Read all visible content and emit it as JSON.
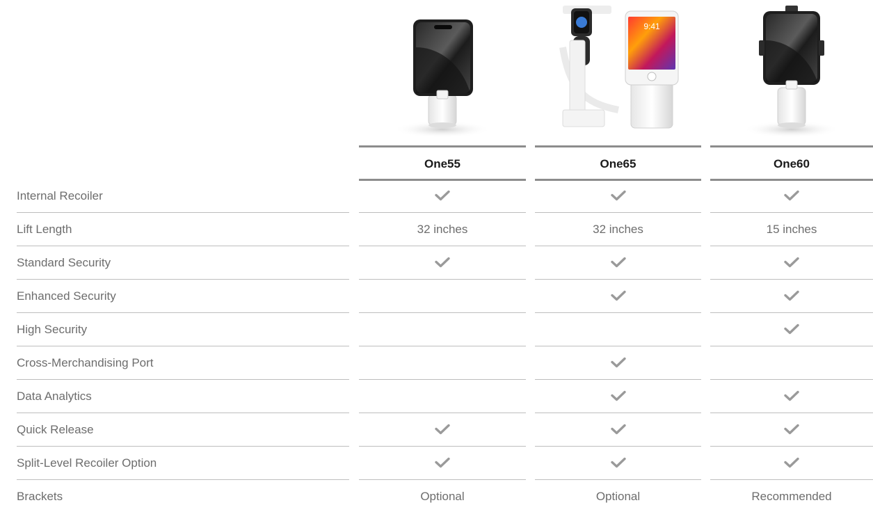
{
  "products": [
    {
      "name": "One55",
      "image_icon": "phone-stand-one55-icon"
    },
    {
      "name": "One65",
      "image_icon": "phone-watch-stand-one65-icon"
    },
    {
      "name": "One60",
      "image_icon": "phone-stand-one60-icon"
    }
  ],
  "product_image_text": {
    "phone_clock": "9:41"
  },
  "rows": [
    {
      "label": "Internal Recoiler",
      "values": [
        "check",
        "check",
        "check"
      ]
    },
    {
      "label": "Lift Length",
      "values": [
        "32 inches",
        "32 inches",
        "15 inches"
      ]
    },
    {
      "label": "Standard Security",
      "values": [
        "check",
        "check",
        "check"
      ]
    },
    {
      "label": "Enhanced Security",
      "values": [
        "",
        "check",
        "check"
      ]
    },
    {
      "label": "High Security",
      "values": [
        "",
        "",
        "check"
      ]
    },
    {
      "label": "Cross-Merchandising Port",
      "values": [
        "",
        "check",
        ""
      ]
    },
    {
      "label": "Data Analytics",
      "values": [
        "",
        "check",
        "check"
      ]
    },
    {
      "label": "Quick Release",
      "values": [
        "check",
        "check",
        "check"
      ]
    },
    {
      "label": "Split-Level Recoiler Option",
      "values": [
        "check",
        "check",
        "check"
      ]
    },
    {
      "label": "Brackets",
      "values": [
        "Optional",
        "Optional",
        "Recommended"
      ]
    }
  ],
  "colors": {
    "check": "#9a9a9a",
    "divider": "#bdbdbd",
    "header_bar": "#8c8c8c",
    "title": "#1a1a1a",
    "text": "#6d6d6d"
  }
}
